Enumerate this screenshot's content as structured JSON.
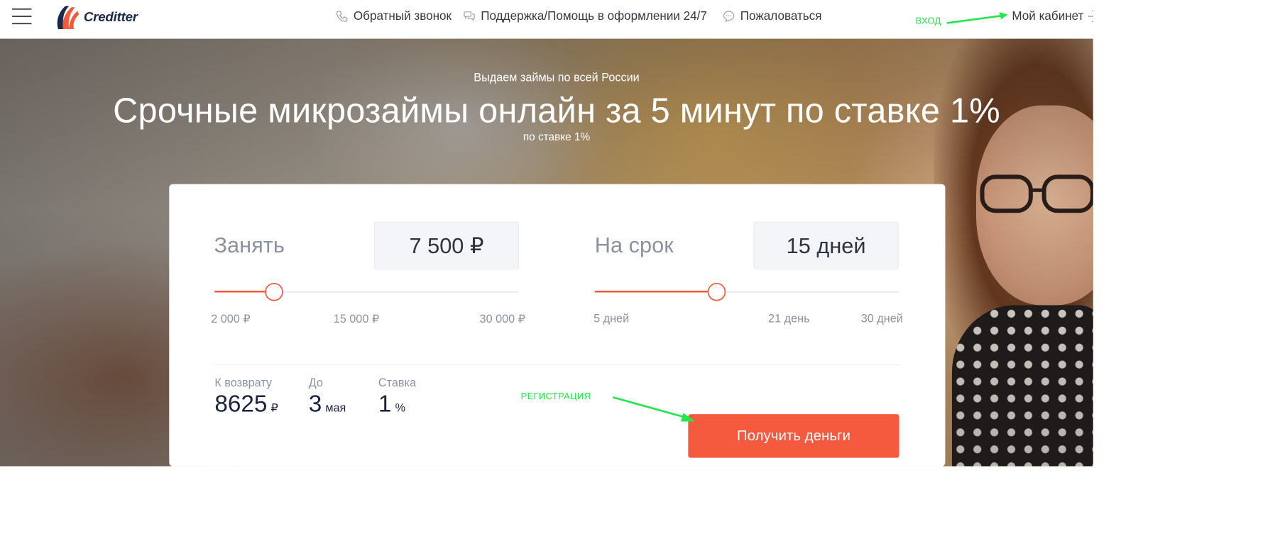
{
  "header": {
    "brand": "Creditter",
    "nav": {
      "callback": "Обратный звонок",
      "support": "Поддержка/Помощь в оформлении 24/7",
      "complain": "Пожаловаться"
    },
    "cabinet": "Мой кабинет",
    "annotation_login": "ВХОД"
  },
  "hero": {
    "eyebrow": "Выдаем займы по всей России",
    "title": "Срочные микрозаймы онлайн за 5 минут по ставке 1%",
    "subtitle": "по ставке 1%"
  },
  "calculator": {
    "amount": {
      "label": "Занять",
      "value": "7 500 ₽",
      "min": 2000,
      "max": 30000,
      "current": 7500,
      "ticks": [
        "2 000 ₽",
        "15 000 ₽",
        "30 000 ₽"
      ]
    },
    "term": {
      "label": "На срок",
      "value": "15 дней",
      "min": 5,
      "max": 30,
      "current": 15,
      "ticks": [
        "5 дней",
        "21 день",
        "30 дней"
      ]
    },
    "summary": {
      "return_label": "К возврату",
      "return_value": "8625",
      "return_unit": "₽",
      "until_label": "До",
      "until_value": "3",
      "until_unit": "мая",
      "rate_label": "Ставка",
      "rate_value": "1",
      "rate_unit": "%"
    },
    "cta": "Получить деньги",
    "annotation_register": "РЕГИСТРАЦИЯ"
  },
  "colors": {
    "accent": "#f55a3f",
    "annotation": "#1ee84a",
    "label": "#8b93a3",
    "brand_text": "#1b2a4a"
  }
}
